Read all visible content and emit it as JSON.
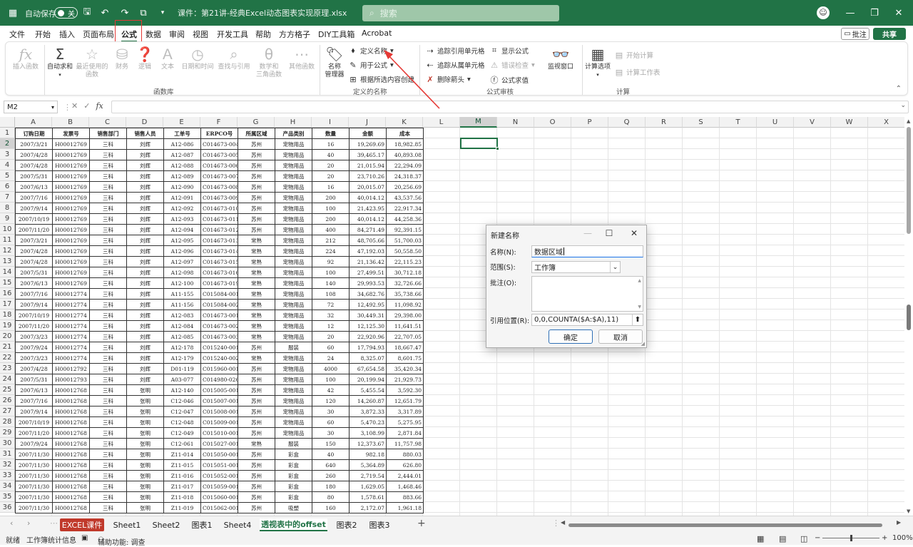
{
  "titlebar": {
    "autosave_label": "自动保存",
    "autosave_state": "关",
    "file_title": "课件：第21讲-经典Excel动态图表实现原理.xlsx",
    "search_placeholder": "搜索"
  },
  "menu": {
    "tabs": [
      "文件",
      "开始",
      "插入",
      "页面布局",
      "公式",
      "数据",
      "审阅",
      "视图",
      "开发工具",
      "帮助",
      "方方格子",
      "DIY工具箱",
      "Acrobat"
    ],
    "active": "公式",
    "comment_label": "批注",
    "share_label": "共享"
  },
  "ribbon": {
    "insert_function": "插入函数",
    "autosum": "自动求和",
    "recent_line1": "最近使用的",
    "recent_line2": "函数",
    "finance": "财务",
    "logic": "逻辑",
    "text": "文本",
    "datetime": "日期和时间",
    "lookup": "查找与引用",
    "math_line1": "数学和",
    "math_line2": "三角函数",
    "other": "其他函数",
    "group_library": "函数库",
    "name_manager_line1": "名称",
    "name_manager_line2": "管理器",
    "define_name": "定义名称",
    "use_in_formula": "用于公式",
    "create_from_selection": "根据所选内容创建",
    "group_names": "定义的名称",
    "trace_precedents": "追踪引用单元格",
    "trace_dependents": "追踪从属单元格",
    "remove_arrows": "删除箭头",
    "show_formulas": "显示公式",
    "error_checking": "错误检查",
    "evaluate_formula": "公式求值",
    "group_audit": "公式审核",
    "watch_window": "监视窗口",
    "calc_options": "计算选项",
    "calc_now": "开始计算",
    "calc_sheet": "计算工作表",
    "group_calc": "计算"
  },
  "formula_bar": {
    "name_box": "M2",
    "formula": ""
  },
  "grid": {
    "columns": [
      "A",
      "B",
      "C",
      "D",
      "E",
      "F",
      "G",
      "H",
      "I",
      "J",
      "K",
      "L",
      "M",
      "N",
      "O",
      "P",
      "Q",
      "R",
      "S",
      "T",
      "U",
      "V",
      "W",
      "X"
    ],
    "selected_column": "M",
    "selected_row": "2",
    "rows": [
      "1",
      "2",
      "3",
      "4",
      "5",
      "6",
      "7",
      "8",
      "9",
      "10",
      "11",
      "12",
      "13",
      "14",
      "15",
      "16",
      "17",
      "18",
      "19",
      "20",
      "21",
      "22",
      "23",
      "24",
      "25",
      "26",
      "27",
      "28",
      "29",
      "30",
      "31",
      "32",
      "33",
      "34",
      "35",
      "36"
    ],
    "headers": [
      "订购日期",
      "发票号",
      "销售部门",
      "销售人员",
      "工单号",
      "ERPCO号",
      "所属区域",
      "产品类别",
      "数量",
      "金额",
      "成本"
    ],
    "data": [
      [
        "2007/3/21",
        "H00012769",
        "三科",
        "刘辉",
        "A12-086",
        "C014673-004",
        "苏州",
        "宠物用品",
        "16",
        "19,269.69",
        "18,982.85"
      ],
      [
        "2007/4/28",
        "H00012769",
        "三科",
        "刘辉",
        "A12-087",
        "C014673-005",
        "苏州",
        "宠物用品",
        "40",
        "39,465.17",
        "40,893.08"
      ],
      [
        "2007/4/28",
        "H00012769",
        "三科",
        "刘辉",
        "A12-088",
        "C014673-006",
        "苏州",
        "宠物用品",
        "20",
        "21,015.94",
        "22,294.09"
      ],
      [
        "2007/5/31",
        "H00012769",
        "三科",
        "刘辉",
        "A12-089",
        "C014673-007",
        "苏州",
        "宠物用品",
        "20",
        "23,710.26",
        "24,318.37"
      ],
      [
        "2007/6/13",
        "H00012769",
        "三科",
        "刘辉",
        "A12-090",
        "C014673-008",
        "苏州",
        "宠物用品",
        "16",
        "20,015.07",
        "20,256.69"
      ],
      [
        "2007/7/16",
        "H00012769",
        "三科",
        "刘辉",
        "A12-091",
        "C014673-009",
        "苏州",
        "宠物用品",
        "200",
        "40,014.12",
        "43,537.56"
      ],
      [
        "2007/9/14",
        "H00012769",
        "三科",
        "刘辉",
        "A12-092",
        "C014673-010",
        "苏州",
        "宠物用品",
        "100",
        "21,423.95",
        "22,917.34"
      ],
      [
        "2007/10/19",
        "H00012769",
        "三科",
        "刘辉",
        "A12-093",
        "C014673-011",
        "苏州",
        "宠物用品",
        "200",
        "40,014.12",
        "44,258.36"
      ],
      [
        "2007/11/20",
        "H00012769",
        "三科",
        "刘辉",
        "A12-094",
        "C014673-012",
        "苏州",
        "宠物用品",
        "400",
        "84,271.49",
        "92,391.15"
      ],
      [
        "2007/3/21",
        "H00012769",
        "三科",
        "刘辉",
        "A12-095",
        "C014673-013",
        "常熟",
        "宠物用品",
        "212",
        "48,705.66",
        "51,700.03"
      ],
      [
        "2007/4/28",
        "H00012769",
        "三科",
        "刘辉",
        "A12-096",
        "C014673-014",
        "常熟",
        "宠物用品",
        "224",
        "47,192.03",
        "50,558.50"
      ],
      [
        "2007/4/28",
        "H00012769",
        "三科",
        "刘辉",
        "A12-097",
        "C014673-015",
        "常熟",
        "宠物用品",
        "92",
        "21,136.42",
        "22,115.23"
      ],
      [
        "2007/5/31",
        "H00012769",
        "三科",
        "刘辉",
        "A12-098",
        "C014673-016",
        "常熟",
        "宠物用品",
        "100",
        "27,499.51",
        "30,712.18"
      ],
      [
        "2007/6/13",
        "H00012769",
        "三科",
        "刘辉",
        "A12-100",
        "C014673-019",
        "常熟",
        "宠物用品",
        "140",
        "29,993.53",
        "32,726.66"
      ],
      [
        "2007/7/16",
        "H00012774",
        "三科",
        "刘辉",
        "A11-155",
        "C015084-001",
        "常熟",
        "宠物用品",
        "108",
        "34,682.76",
        "35,738.66"
      ],
      [
        "2007/9/14",
        "H00012774",
        "三科",
        "刘辉",
        "A11-156",
        "C015084-002",
        "常熟",
        "宠物用品",
        "72",
        "12,492.95",
        "11,098.92"
      ],
      [
        "2007/10/19",
        "H00012774",
        "三科",
        "刘辉",
        "A12-083",
        "C014673-001",
        "常熟",
        "宠物用品",
        "32",
        "30,449.31",
        "29,398.00"
      ],
      [
        "2007/11/20",
        "H00012774",
        "三科",
        "刘辉",
        "A12-084",
        "C014673-002",
        "常熟",
        "宠物用品",
        "12",
        "12,125.30",
        "11,641.51"
      ],
      [
        "2007/3/23",
        "H00012774",
        "三科",
        "刘辉",
        "A12-085",
        "C014673-003",
        "常熟",
        "宠物用品",
        "20",
        "22,920.96",
        "22,707.05"
      ],
      [
        "2007/9/24",
        "H00012774",
        "三科",
        "刘辉",
        "A12-178",
        "C015240-001",
        "苏州",
        "服装",
        "60",
        "17,794.93",
        "18,667.47"
      ],
      [
        "2007/3/23",
        "H00012774",
        "三科",
        "刘辉",
        "A12-179",
        "C015240-002",
        "常熟",
        "宠物用品",
        "24",
        "8,325.07",
        "8,601.75"
      ],
      [
        "2007/4/28",
        "H00012792",
        "三科",
        "刘辉",
        "D01-119",
        "C015960-001",
        "苏州",
        "宠物用品",
        "4000",
        "67,654.58",
        "35,420.34"
      ],
      [
        "2007/5/31",
        "H00012793",
        "三科",
        "刘辉",
        "A03-077",
        "C014980-026",
        "苏州",
        "宠物用品",
        "100",
        "20,199.94",
        "21,929.73"
      ],
      [
        "2007/6/13",
        "H00012768",
        "三科",
        "张明",
        "A12-140",
        "C015005-001",
        "苏州",
        "宠物用品",
        "42",
        "5,455.54",
        "3,592.30"
      ],
      [
        "2007/7/16",
        "H00012768",
        "三科",
        "张明",
        "C12-046",
        "C015007-001",
        "苏州",
        "宠物用品",
        "120",
        "14,260.87",
        "12,651.79"
      ],
      [
        "2007/9/14",
        "H00012768",
        "三科",
        "张明",
        "C12-047",
        "C015008-001",
        "苏州",
        "宠物用品",
        "30",
        "3,872.33",
        "3,317.89"
      ],
      [
        "2007/10/19",
        "H00012768",
        "三科",
        "张明",
        "C12-048",
        "C015009-001",
        "苏州",
        "宠物用品",
        "60",
        "5,470.23",
        "5,275.95"
      ],
      [
        "2007/11/20",
        "H00012768",
        "三科",
        "张明",
        "C12-049",
        "C015010-001",
        "苏州",
        "宠物用品",
        "30",
        "3,108.99",
        "2,871.84"
      ],
      [
        "2007/9/24",
        "H00012768",
        "三科",
        "张明",
        "C12-061",
        "C015027-001",
        "常熟",
        "服装",
        "150",
        "12,373.67",
        "11,757.98"
      ],
      [
        "2007/11/30",
        "H00012768",
        "三科",
        "张明",
        "Z11-014",
        "C015050-001",
        "苏州",
        "彩盒",
        "40",
        "982.18",
        "880.03"
      ],
      [
        "2007/11/30",
        "H00012768",
        "三科",
        "张明",
        "Z11-015",
        "C015051-001",
        "苏州",
        "彩盒",
        "640",
        "5,364.89",
        "626.80"
      ],
      [
        "2007/11/30",
        "H00012768",
        "三科",
        "张明",
        "Z11-016",
        "C015052-001",
        "苏州",
        "彩盒",
        "260",
        "2,719.54",
        "2,444.01"
      ],
      [
        "2007/11/30",
        "H00012768",
        "三科",
        "张明",
        "Z11-017",
        "C015059-001",
        "苏州",
        "彩盒",
        "180",
        "1,629.05",
        "1,468.46"
      ],
      [
        "2007/11/30",
        "H00012768",
        "三科",
        "张明",
        "Z11-018",
        "C015060-001",
        "苏州",
        "彩盒",
        "80",
        "1,578.61",
        "883.66"
      ],
      [
        "2007/11/30",
        "H00012768",
        "三科",
        "张明",
        "Z11-019",
        "C015062-001",
        "苏州",
        "吸塑",
        "160",
        "2,172.07",
        "1,961.18"
      ]
    ]
  },
  "dialog": {
    "title": "新建名称",
    "name_label": "名称(N):",
    "name_value": "数据区域",
    "scope_label": "范围(S):",
    "scope_value": "工作簿",
    "comment_label": "批注(O):",
    "ref_label": "引用位置(R):",
    "ref_value": "0,0,COUNTA($A:$A),11)",
    "ok": "确定",
    "cancel": "取消"
  },
  "sheets": {
    "tabs": [
      "EXCEL课件",
      "Sheet1",
      "Sheet2",
      "图表1",
      "Sheet4",
      "透视表中的offset",
      "图表2",
      "图表3"
    ],
    "active": "透视表中的offset",
    "add": "+"
  },
  "statusbar": {
    "ready": "就绪",
    "stats": "工作簿统计信息",
    "accessibility": "辅助功能: 调查",
    "zoom": "100%"
  },
  "colors": {
    "excel_green": "#217346",
    "highlight_red": "#e53935"
  }
}
